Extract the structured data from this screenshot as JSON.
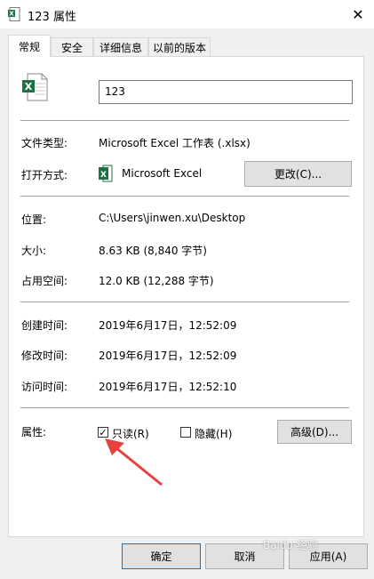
{
  "window": {
    "title": "123 属性",
    "close_glyph": "✕"
  },
  "tabs": [
    {
      "label": "常规",
      "active": true
    },
    {
      "label": "安全",
      "active": false
    },
    {
      "label": "详细信息",
      "active": false
    },
    {
      "label": "以前的版本",
      "active": false
    }
  ],
  "general": {
    "file_name": "123",
    "rows": {
      "type_label": "文件类型:",
      "type_value": "Microsoft Excel 工作表 (.xlsx)",
      "opens_with_label": "打开方式:",
      "opens_with_value": "Microsoft Excel",
      "change_button": "更改(C)...",
      "location_label": "位置:",
      "location_value": "C:\\Users\\jinwen.xu\\Desktop",
      "size_label": "大小:",
      "size_value": "8.63 KB (8,840 字节)",
      "size_on_disk_label": "占用空间:",
      "size_on_disk_value": "12.0 KB (12,288 字节)",
      "created_label": "创建时间:",
      "created_value": "2019年6月17日，12:52:09",
      "modified_label": "修改时间:",
      "modified_value": "2019年6月17日，12:52:09",
      "accessed_label": "访问时间:",
      "accessed_value": "2019年6月17日，12:52:10"
    },
    "attributes": {
      "label": "属性:",
      "readonly_label": "只读(R)",
      "readonly_checked": true,
      "hidden_label": "隐藏(H)",
      "hidden_checked": false,
      "advanced_button": "高级(D)..."
    }
  },
  "footer": {
    "ok": "确定",
    "cancel": "取消",
    "apply": "应用(A)"
  },
  "colors": {
    "excel_green": "#1e7145",
    "arrow_red": "#e8413f"
  },
  "watermark": "Baidu 经验"
}
